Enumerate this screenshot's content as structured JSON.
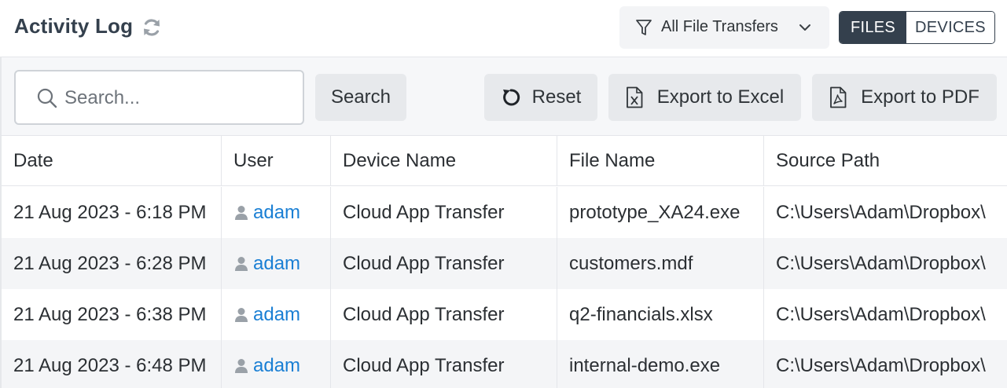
{
  "header": {
    "title": "Activity Log",
    "filter_label": "All File Transfers",
    "segment": {
      "files_label": "FILES",
      "devices_label": "DEVICES",
      "active": "FILES"
    }
  },
  "toolbar": {
    "search_placeholder": "Search...",
    "search_label": "Search",
    "reset_label": "Reset",
    "excel_label": "Export to Excel",
    "pdf_label": "Export to PDF"
  },
  "table": {
    "columns": [
      "Date",
      "User",
      "Device Name",
      "File Name",
      "Source Path"
    ],
    "rows": [
      {
        "date": "21 Aug 2023 - 6:18 PM",
        "user": "adam",
        "device": "Cloud App Transfer",
        "file": "prototype_XA24.exe",
        "path": "C:\\Users\\Adam\\Dropbox\\"
      },
      {
        "date": "21 Aug 2023 - 6:28 PM",
        "user": "adam",
        "device": "Cloud App Transfer",
        "file": "customers.mdf",
        "path": "C:\\Users\\Adam\\Dropbox\\"
      },
      {
        "date": "21 Aug 2023 - 6:38 PM",
        "user": "adam",
        "device": "Cloud App Transfer",
        "file": "q2-financials.xlsx",
        "path": "C:\\Users\\Adam\\Dropbox\\"
      },
      {
        "date": "21 Aug 2023 - 6:48 PM",
        "user": "adam",
        "device": "Cloud App Transfer",
        "file": "internal-demo.exe",
        "path": "C:\\Users\\Adam\\Dropbox\\"
      }
    ]
  },
  "colors": {
    "primary": "#34404d",
    "link": "#1a7fd4",
    "button_bg": "#e7e9ec",
    "toolbar_bg": "#f6f7f9"
  },
  "icons": [
    "refresh-icon",
    "filter-icon",
    "chevron-down-icon",
    "search-icon",
    "reset-icon",
    "excel-icon",
    "pdf-icon",
    "user-icon"
  ]
}
